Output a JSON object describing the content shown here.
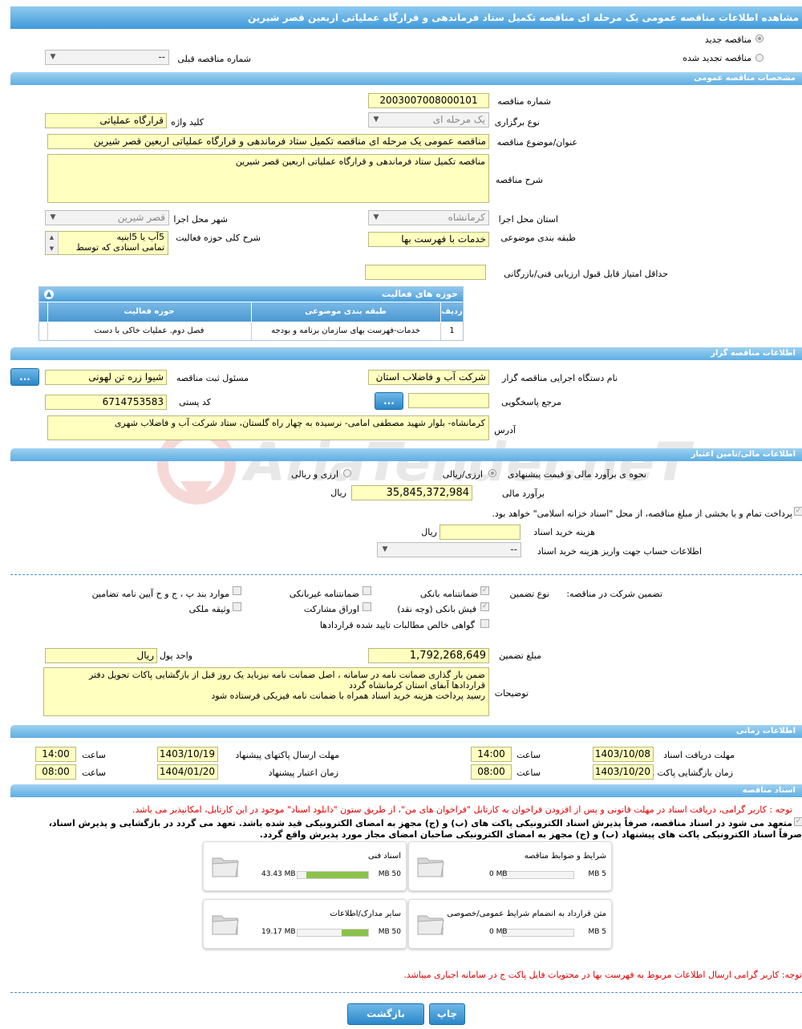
{
  "header": {
    "title": "مشاهده اطلاعات مناقصه عمومی یک مرحله ای مناقصه تکمیل ستاد فرماندهی و قرارگاه عملیاتی اربعین قصر شیرین"
  },
  "tender_type": {
    "new_label": "مناقصه جدید",
    "renewed_label": "مناقصه تجدید شده",
    "prev_number_label": "شماره مناقصه قبلی",
    "prev_number_value": "--"
  },
  "general": {
    "section_title": "مشخصات مناقصه عمومی",
    "number_label": "شماره مناقصه",
    "number_value": "2003007008000101",
    "method_label": "نوع برگزاری",
    "method_value": "یک مرحله ای",
    "keyword_label": "کلید واژه",
    "keyword_value": "قرارگاه عملیاتی",
    "subject_label": "عنوان/موضوع مناقصه",
    "subject_value": "مناقصه عمومی یک مرحله ای مناقصه تکمیل ستاد فرماندهی و قرارگاه عملیاتی اربعین قصر شیرین",
    "desc_label": "شرح مناقصه",
    "desc_value": "مناقصه تکمیل ستاد فرماندهی و قرارگاه عملیاتی اربعین قصر شیرین",
    "province_label": "استان محل اجرا",
    "province_value": "کرمانشاه",
    "city_label": "شهر محل اجرا",
    "city_value": "قصر شیرین",
    "category_label": "طبقه بندی موضوعی",
    "category_value": "خدمات با فهرست بها",
    "activity_desc_label": "شرح کلی حوزه فعالیت",
    "activity_desc_line1": "5آب یا 5ابنیه",
    "activity_desc_line2": "تمامی اسنادی که توسط",
    "min_score_label": "حداقل امتیاز قابل قبول ارزیابی فنی/بازرگانی",
    "min_score_value": ""
  },
  "activity_table": {
    "title": "حوزه های فعالیت",
    "headers": [
      "ردیف",
      "طبقه بندی موضوعی",
      "حوزه فعالیت"
    ],
    "rows": [
      [
        "1",
        "خدمات-فهرست بهای سازمان برنامه و بودجه",
        "فصل دوم. عملیات خاکی با دست"
      ]
    ]
  },
  "organizer": {
    "section_title": "اطلاعات مناقصه گزار",
    "org_label": "نام دستگاه اجرایی مناقصه گزار",
    "org_value": "شرکت آب و فاضلاب استان",
    "registrar_label": "مسئول ثبت مناقصه",
    "registrar_value": "شیوا زره تن لهونی",
    "response_label": "مرجع پاسخگویی",
    "response_value": "",
    "postal_label": "کد پستی",
    "postal_value": "6714753583",
    "address_label": "آدرس",
    "address_value": "کرمانشاه- بلوار شهید مصطفی امامی- نرسیده به چهار راه گلستان، ستاد شرکت  آب و فاضلاب شهری",
    "more_button": "..."
  },
  "finance": {
    "section_title": "اطلاعات مالی/تامین اعتبار",
    "estimate_type_label": "نحوه ی برآورد مالی و قیمت پیشنهادی",
    "opt_currency_rial": "ارزی/ریالی",
    "opt_rial": "ارزی و ریالی",
    "estimate_label": "برآورد مالی",
    "estimate_value": "35,845,372,984",
    "estimate_unit": "ریال",
    "islamic_treasury_text": "پرداخت تمام و یا بخشی از مبلغ مناقصه، از محل \"اسناد خزانه اسلامی\" خواهد بود.",
    "doc_cost_label": "هزینه خرید اسناد",
    "doc_cost_value": "",
    "doc_cost_unit": "ریال",
    "account_label": "اطلاعات حساب جهت واریز هزینه خرید اسناد",
    "account_value": "--"
  },
  "guarantee": {
    "label": "تضمین شرکت در مناقصه:",
    "type_label": "نوع تضمین",
    "opt_bank": "ضمانتنامه بانکی",
    "opt_nonbank": "ضمانتنامه غیربانکی",
    "opt_clauses": "موارد بند پ ، ج و ح آیین نامه تضامین",
    "opt_cash": "فیش بانکی (وجه نقد)",
    "opt_bonds": "اوراق مشارکت",
    "opt_property": "وثیقه ملکی",
    "opt_cert": "گواهی خالص مطالبات تایید شده قراردادها",
    "amount_label": "مبلغ تضمین",
    "amount_value": "1,792,268,649",
    "currency_label": "واحد پول",
    "currency_value": "ریال",
    "notes_label": "توضیحات",
    "notes_line1": "ضمن بار گذاری ضمانت نامه در سامانه ، اصل ضمانت نامه نیزباید یک روز قبل از بازگشایی پاکات تحویل دفتر",
    "notes_line2": "قراردادها آبفای استان کرمانشاه گردد",
    "notes_line3": "رسید پرداخت هزینه خرید اسناد همراه با ضمانت نامه فیزیکی فرستاده شود"
  },
  "timing": {
    "section_title": "اطلاعات زمانی",
    "receive_label": "مهلت دریافت اسناد",
    "receive_date": "1403/10/08",
    "receive_time": "14:00",
    "send_label": "مهلت ارسال پاکتهای پیشنهاد",
    "send_date": "1403/10/19",
    "send_time": "14:00",
    "open_label": "زمان بازگشایی پاکت ها",
    "open_date": "1403/10/20",
    "open_time": "08:00",
    "valid_label": "زمان اعتبار پیشنهاد",
    "valid_date": "1404/01/20",
    "valid_time": "08:00",
    "time_label": "ساعت"
  },
  "documents": {
    "section_title": "اسناد مناقصه",
    "notice_red": "توجه : کاربر گرامی، دریافت اسناد در مهلت قانونی و پس از افزودن فراخوان به کارتابل \"فراخوان های من\"، از طریق ستون \"دانلود اسناد\" موجود در این کارتابل، امکانپذیر می باشد.",
    "commit_line1": "متعهد می شود در اسناد مناقصه، صرفاً پذیرش اسناد الکترونیکی پاکت های (ب) و (ج) مجهز به امضای الکترونیکی قید شده باشد. تعهد می گردد در بازگشایی و پذیرش اسناد،",
    "commit_line2": "صرفاً اسناد الکترونیکی پاکت های پیشنهاد (ب) و (ج) مجهز به امضای الکترونیکی صاحبان امضای مجاز مورد پذیرش واقع گردد.",
    "cards": [
      {
        "title": "شرایط و ضوابط مناقصه",
        "current": "0 MB",
        "max": "5 MB",
        "fill": 0
      },
      {
        "title": "اسناد فنی",
        "current": "43.43 MB",
        "max": "50 MB",
        "fill": 0.87
      },
      {
        "title": "متن قرارداد به انضمام شرایط عمومی/خصوصی",
        "current": "0 MB",
        "max": "5 MB",
        "fill": 0
      },
      {
        "title": "سایر مدارک/اطلاعات",
        "current": "19.17 MB",
        "max": "50 MB",
        "fill": 0.38
      }
    ],
    "notice_red2": "توجه: کاربر گرامی ارسال اطلاعات مربوط به فهرست بها در محتویات فایل پاکت ج در سامانه اجباری میباشد."
  },
  "footer": {
    "print_button": "چاپ",
    "back_button": "بازگشت"
  },
  "watermark": {
    "text": "AriaTender.neT"
  },
  "colors": {
    "header": "#3f9ad9",
    "input_bg": "#ffffc0",
    "progress": "#8bc34a",
    "red": "#e30000"
  }
}
